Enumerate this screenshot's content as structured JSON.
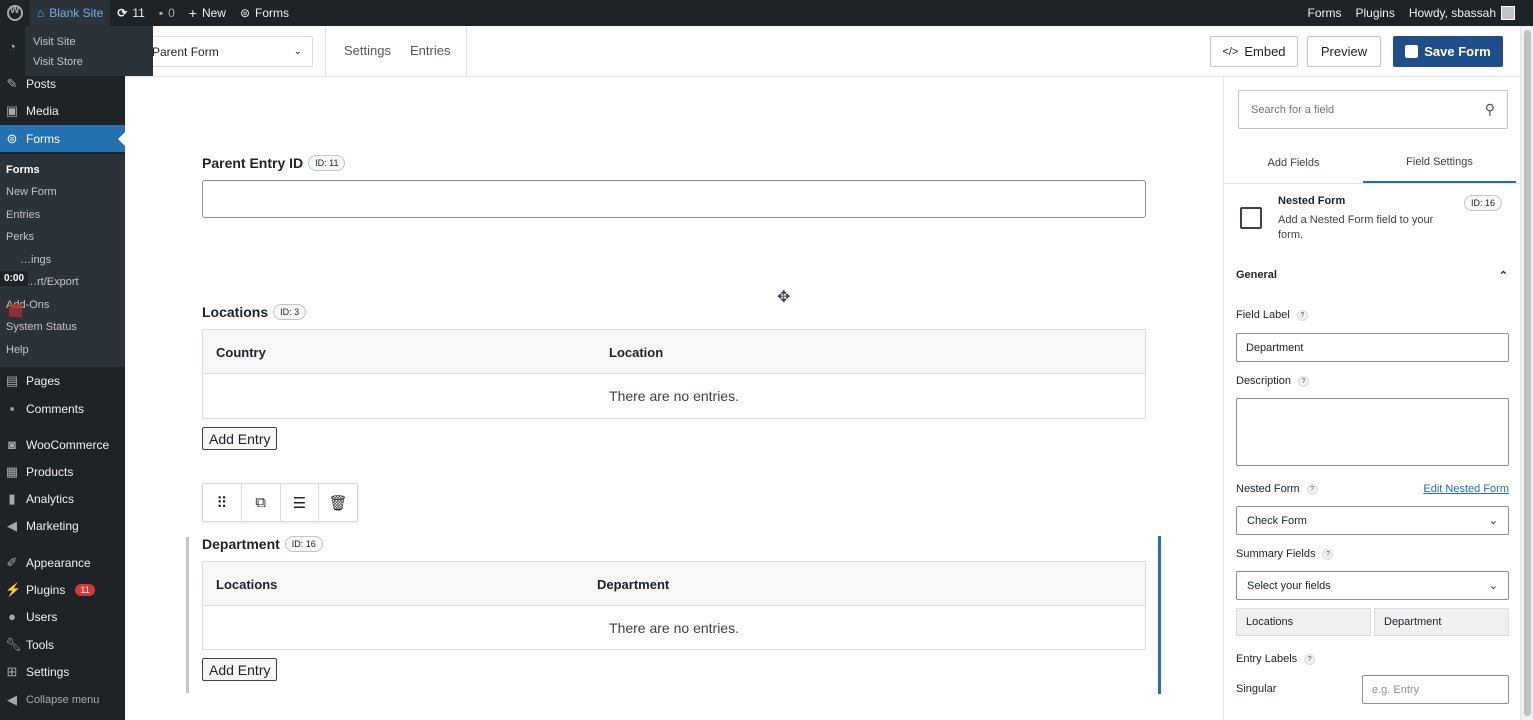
{
  "adminbar": {
    "site_name": "Blank Site",
    "updates_count": "11",
    "comments_count": "0",
    "new_label": "New",
    "forms_label": "Forms",
    "right_forms": "Forms",
    "right_plugins": "Plugins",
    "howdy": "Howdy, sbassah"
  },
  "site_dropdown": {
    "visit_site": "Visit Site",
    "visit_store": "Visit Store"
  },
  "sidebar": {
    "posts": "Posts",
    "media": "Media",
    "forms": "Forms",
    "sub": {
      "forms": "Forms",
      "new_form": "New Form",
      "entries": "Entries",
      "perks": "Perks",
      "settings_partial": "…ings",
      "import_partial": "…rt/Export",
      "addons": "Add-Ons",
      "system_status": "System Status",
      "help": "Help"
    },
    "pages": "Pages",
    "comments": "Comments",
    "woocommerce": "WooCommerce",
    "products": "Products",
    "analytics": "Analytics",
    "marketing": "Marketing",
    "appearance": "Appearance",
    "plugins": "Plugins",
    "plugins_badge": "11",
    "users": "Users",
    "tools": "Tools",
    "settings": "Settings",
    "collapse": "Collapse menu",
    "timer": "0:00"
  },
  "topbar": {
    "form_select": "Parent Form",
    "settings": "Settings",
    "entries": "Entries",
    "embed": "Embed",
    "preview": "Preview",
    "save": "Save Form"
  },
  "canvas": {
    "parent_entry": {
      "label": "Parent Entry ID",
      "id": "ID: 11"
    },
    "locations": {
      "label": "Locations",
      "id": "ID: 3",
      "col1": "Country",
      "col2": "Location",
      "empty": "There are no entries.",
      "add": "Add Entry"
    },
    "department": {
      "label": "Department",
      "id": "ID: 16",
      "col1": "Locations",
      "col2": "Department",
      "empty": "There are no entries.",
      "add": "Add Entry"
    }
  },
  "panel": {
    "search_placeholder": "Search for a field",
    "tab_add": "Add Fields",
    "tab_settings": "Field Settings",
    "field_type": "Nested Form",
    "field_desc": "Add a Nested Form field to your form.",
    "field_id": "ID: 16",
    "section": "General",
    "field_label": "Field Label",
    "field_label_value": "Department",
    "description": "Description",
    "nested_form": "Nested Form",
    "edit_nested": "Edit Nested Form",
    "nested_form_value": "Check Form",
    "summary_fields": "Summary Fields",
    "summary_placeholder": "Select your fields",
    "chips": [
      "Locations",
      "Department"
    ],
    "entry_labels": "Entry Labels",
    "singular": "Singular",
    "singular_placeholder": "e.g. Entry"
  }
}
